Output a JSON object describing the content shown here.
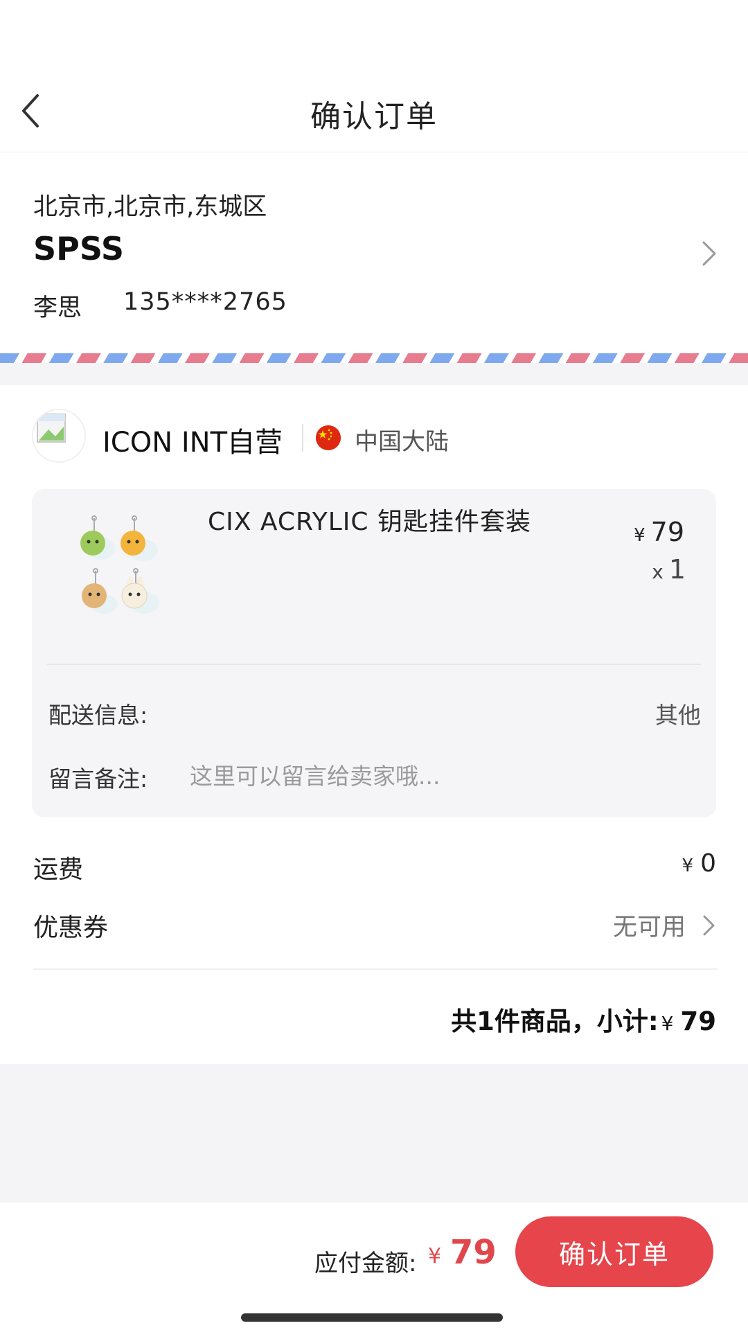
{
  "header": {
    "title": "确认订单"
  },
  "address": {
    "region": "北京市,北京市,东城区",
    "detail": "SPSS",
    "name": "李思",
    "phone": "135****2765"
  },
  "store": {
    "name": "ICON INT自营",
    "region": "中国大陆",
    "logo_icon": "store-logo-image"
  },
  "product": {
    "name": "CIX ACRYLIC 钥匙挂件套装",
    "currency": "¥",
    "price": "79",
    "qty_prefix": "x",
    "qty": "1"
  },
  "delivery": {
    "label": "配送信息:",
    "value": "其他"
  },
  "note": {
    "label": "留言备注:",
    "placeholder": "这里可以留言给卖家哦...",
    "value": ""
  },
  "freight": {
    "label": "运费",
    "currency": "¥",
    "value": "0"
  },
  "coupon": {
    "label": "优惠券",
    "value": "无可用"
  },
  "summary": {
    "text": "共1件商品，小计:",
    "currency": "¥",
    "value": "79"
  },
  "footer": {
    "pay_label": "应付金额:",
    "currency": "¥",
    "amount": "79",
    "confirm_label": "确认订单"
  },
  "colors": {
    "accent": "#e5454b",
    "price_red": "#e0474c",
    "airmail_red": "#e77c8e",
    "airmail_blue": "#7ea9ef",
    "background": "#f4f4f6"
  }
}
